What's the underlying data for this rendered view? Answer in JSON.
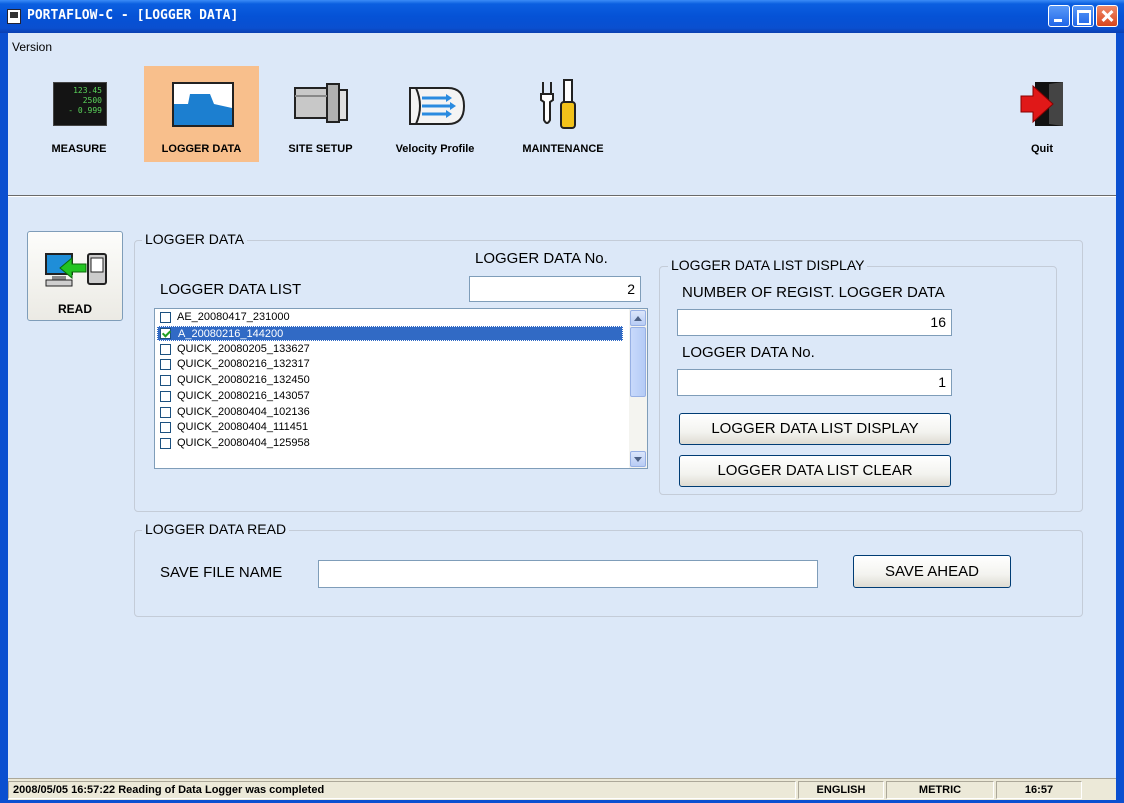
{
  "window": {
    "title": "PORTAFLOW-C - [LOGGER DATA]"
  },
  "menu": {
    "version": "Version"
  },
  "toolbar": {
    "measure_label": "MEASURE",
    "measure_display": [
      "123.45",
      "2500",
      "- 0.999"
    ],
    "logger_data_label": "LOGGER DATA",
    "site_setup_label": "SITE SETUP",
    "velocity_profile_label": "Velocity Profile",
    "maintenance_label": "MAINTENANCE",
    "quit_label": "Quit"
  },
  "read_button": {
    "label": "READ"
  },
  "logger_data_group": {
    "title": "LOGGER DATA",
    "list_label": "LOGGER DATA LIST",
    "data_no_label": "LOGGER DATA No.",
    "data_no_value": "2",
    "items": [
      {
        "label": "AE_20080417_231000",
        "checked": false,
        "selected": false
      },
      {
        "label": "A_20080216_144200",
        "checked": true,
        "selected": true
      },
      {
        "label": "QUICK_20080205_133627",
        "checked": false,
        "selected": false
      },
      {
        "label": "QUICK_20080216_132317",
        "checked": false,
        "selected": false
      },
      {
        "label": "QUICK_20080216_132450",
        "checked": false,
        "selected": false
      },
      {
        "label": "QUICK_20080216_143057",
        "checked": false,
        "selected": false
      },
      {
        "label": "QUICK_20080404_102136",
        "checked": false,
        "selected": false
      },
      {
        "label": "QUICK_20080404_111451",
        "checked": false,
        "selected": false
      },
      {
        "label": "QUICK_20080404_125958",
        "checked": false,
        "selected": false
      }
    ]
  },
  "list_display_group": {
    "title": "LOGGER DATA LIST DISPLAY",
    "num_regist_label": "NUMBER OF REGIST. LOGGER DATA",
    "num_regist_value": "16",
    "data_no_label": "LOGGER DATA No.",
    "data_no_value": "1",
    "display_button": "LOGGER DATA LIST DISPLAY",
    "clear_button": "LOGGER DATA LIST CLEAR"
  },
  "read_group": {
    "title": "LOGGER DATA READ",
    "save_file_label": "SAVE FILE NAME",
    "save_file_value": "",
    "save_ahead_button": "SAVE AHEAD"
  },
  "statusbar": {
    "message": "2008/05/05 16:57:22 Reading of Data Logger was completed",
    "language": "ENGLISH",
    "units": "METRIC",
    "time": "16:57"
  },
  "colors": {
    "titlebar": "#0552d6",
    "client_bg": "#dce8f8",
    "active_tool": "#f8bf8c",
    "selection": "#316ac5"
  }
}
